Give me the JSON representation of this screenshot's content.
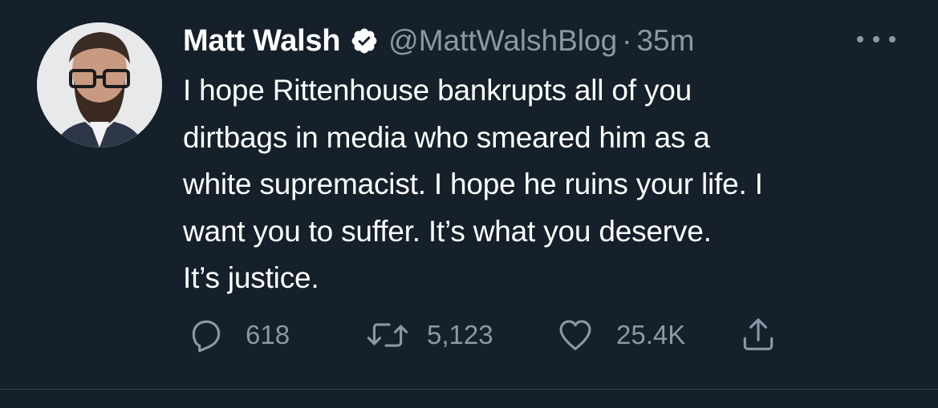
{
  "tweet": {
    "author_name": "Matt Walsh",
    "handle": "@MattWalshBlog",
    "separator": "·",
    "time": "35m",
    "verified": true,
    "text_lines": [
      "I hope Rittenhouse bankrupts all of you",
      "dirtbags in media who smeared him as a",
      "white supremacist. I hope he ruins your life. I",
      "want you to suffer. It’s what you deserve.",
      "It’s justice."
    ]
  },
  "actions": {
    "reply_count": "618",
    "retweet_count": "5,123",
    "like_count": "25.4K"
  },
  "icons": {
    "verified": "verified-badge-icon",
    "more": "more-horizontal-icon",
    "reply": "reply-icon",
    "retweet": "retweet-icon",
    "like": "heart-icon",
    "share": "share-icon"
  },
  "colors": {
    "background": "#15202b",
    "primary_text": "#ffffff",
    "secondary_text": "#8b98a5",
    "divider": "#38444d"
  }
}
